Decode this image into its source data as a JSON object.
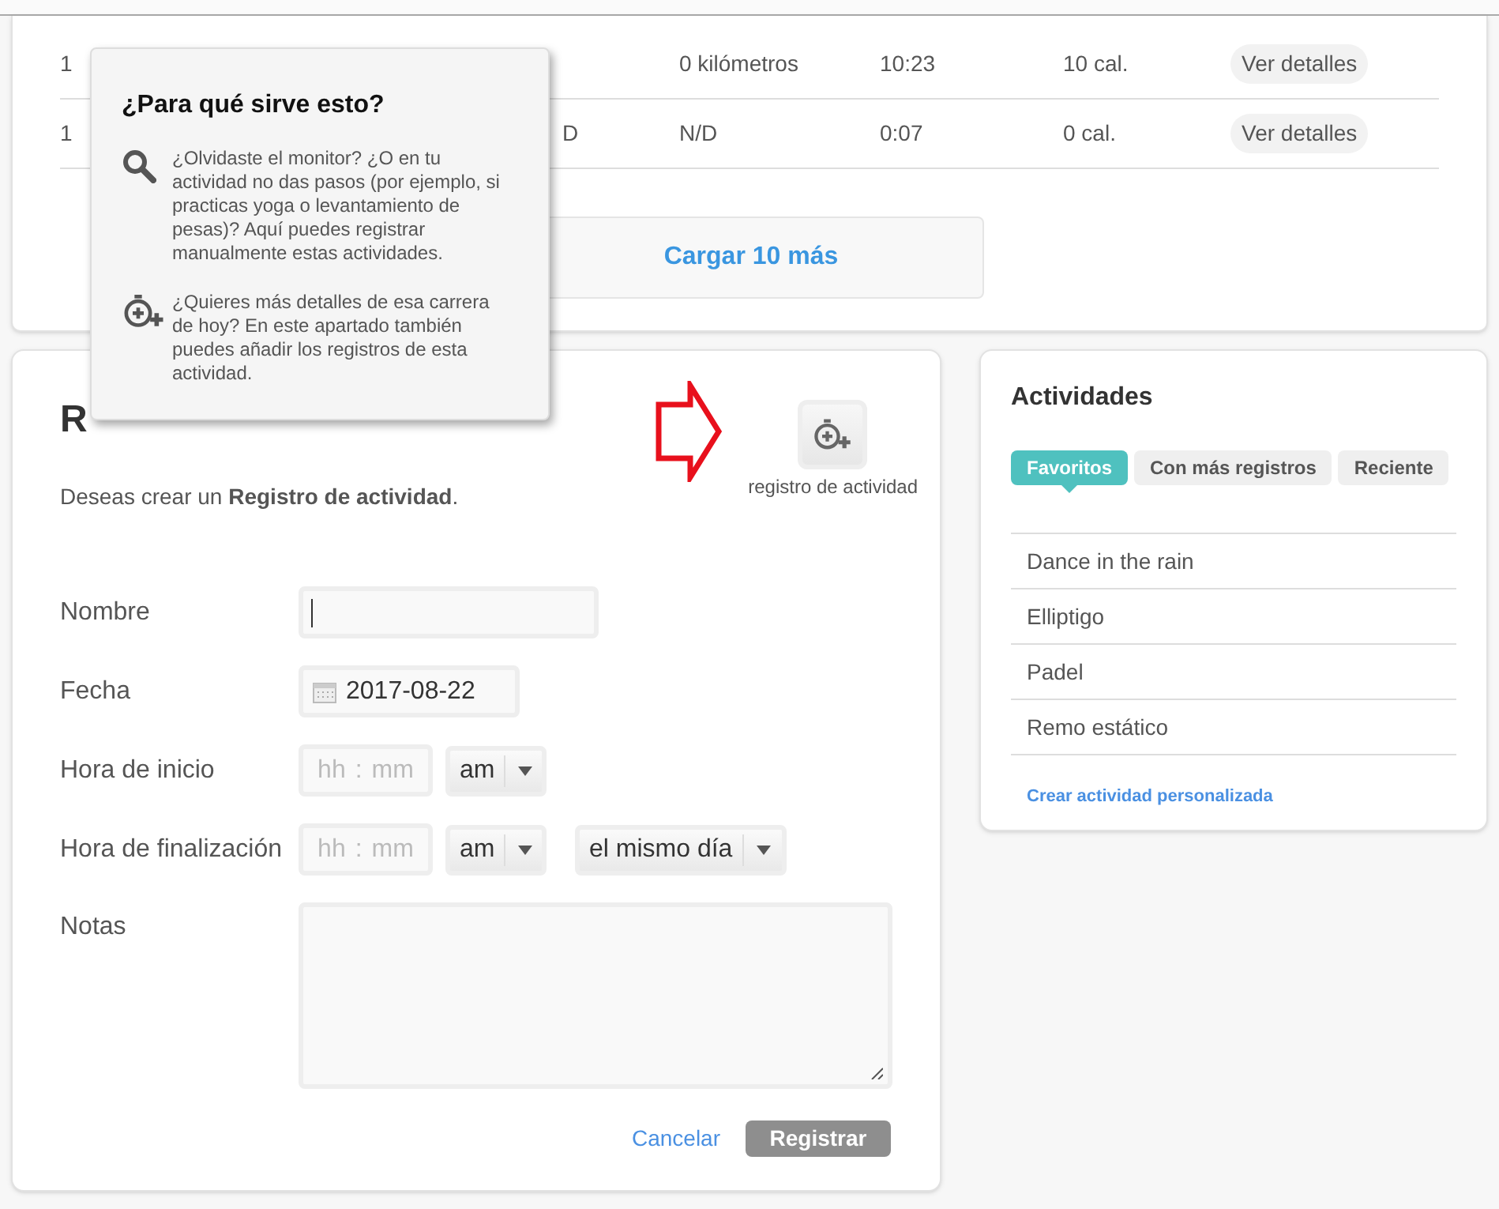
{
  "table": {
    "rows": [
      {
        "column_1": "1",
        "distance": "0 kilómetros",
        "duration": "10:23",
        "calories": "10 cal.",
        "action": "Ver detalles"
      },
      {
        "column_1": "1",
        "column_3": "D",
        "distance": "N/D",
        "duration": "0:07",
        "calories": "0 cal.",
        "action": "Ver detalles"
      }
    ]
  },
  "load_more": "Cargar 10 más",
  "popover": {
    "title": "¿Para qué sirve esto?",
    "items": [
      {
        "kind": "search",
        "text": "¿Olvidaste el monitor? ¿O en tu actividad no das pasos (por ejemplo, si practicas yoga o levantamiento de pesas)? Aquí puedes registrar manualmente estas actividades."
      },
      {
        "kind": "stopwatch",
        "text": "¿Quieres más detalles de esa carrera de hoy? En este apartado también puedes añadir los registros de esta actividad."
      }
    ]
  },
  "form": {
    "title": "R",
    "activity_button_label": "registro de actividad",
    "intro": "Deseas crear un **Registro de actividad**.",
    "fields": [
      {
        "kind": "text",
        "label": "Nombre"
      },
      {
        "kind": "date",
        "label": "Fecha",
        "value": "2017-08-22"
      },
      {
        "kind": "time",
        "label": "Hora de inicio",
        "hour_placeholder": "hh",
        "separator": ":",
        "minute_placeholder": "mm",
        "ampm": "am"
      },
      {
        "kind": "time",
        "label": "Hora de finalización",
        "hour_placeholder": "hh",
        "separator": ":",
        "minute_placeholder": "mm",
        "ampm": "am",
        "day": "el mismo día"
      },
      {
        "kind": "textarea",
        "label": "Notas"
      }
    ],
    "cancel": "Cancelar",
    "submit": "Registrar"
  },
  "activities": {
    "title": "Actividades",
    "tabs": [
      {
        "label": "Favoritos",
        "selected": true
      },
      {
        "label": "Con más registros",
        "selected": false
      },
      {
        "label": "Reciente",
        "selected": false
      }
    ],
    "items": [
      "Dance in the rain",
      "Elliptigo",
      "Padel",
      "Remo estático"
    ],
    "create_link": "Crear actividad personalizada"
  }
}
